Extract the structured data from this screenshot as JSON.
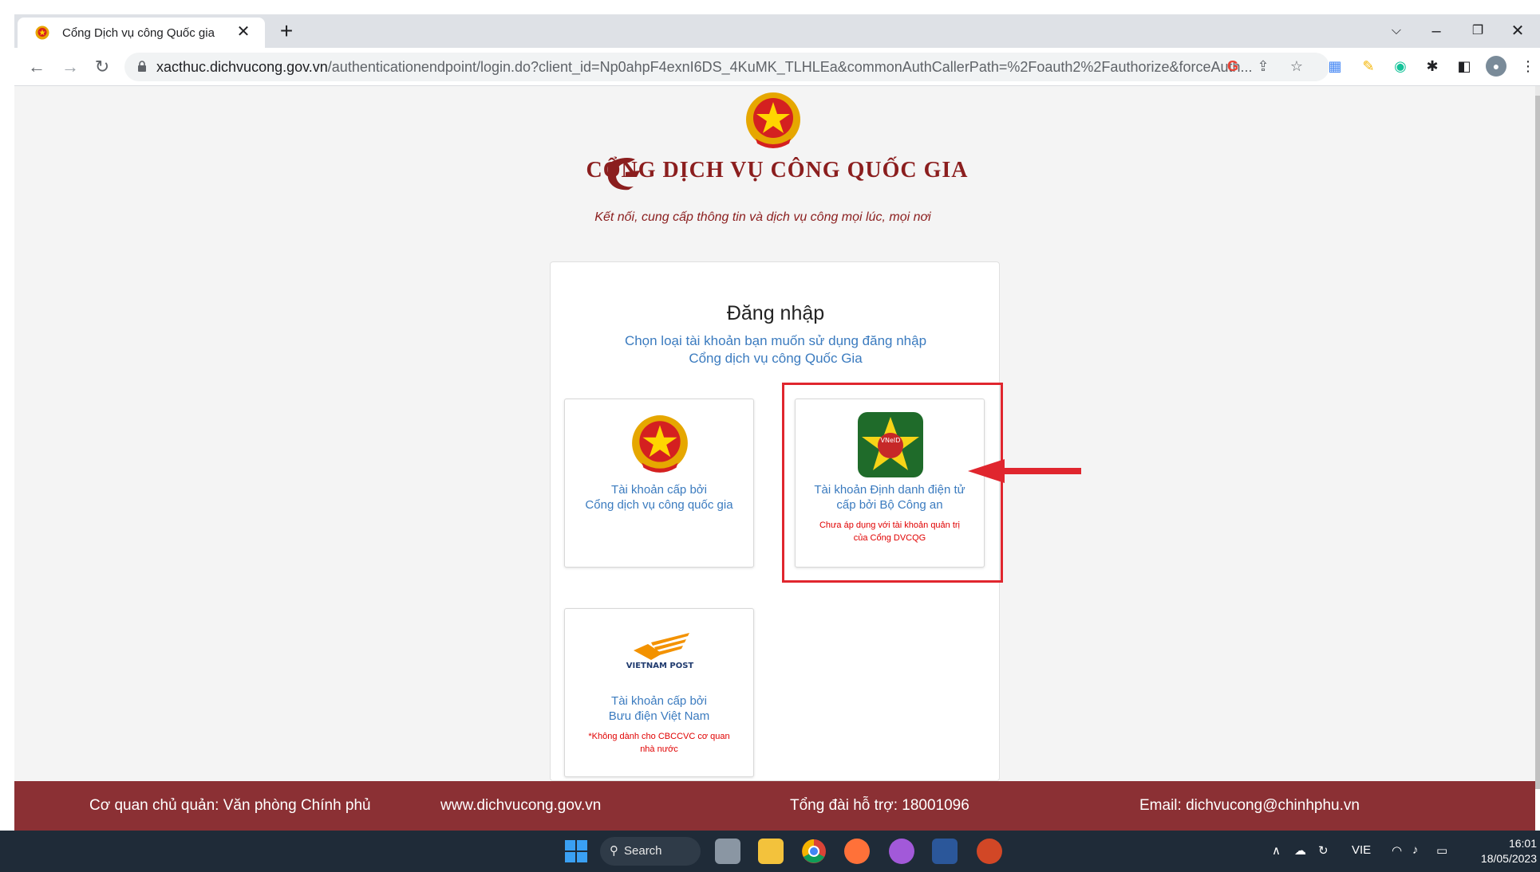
{
  "browser": {
    "tab_title": "Cổng Dịch vụ công Quốc gia",
    "tab_close": "✕",
    "new_tab": "+",
    "url_domain": "xacthuc.dichvucong.gov.vn",
    "url_path": "/authenticationendpoint/login.do?client_id=Np0ahpF4exnI6DS_4KuMK_TLHLEa&commonAuthCallerPath=%2Foauth2%2Fauthorize&forceAuth...",
    "icons": [
      "back-icon",
      "forward-icon",
      "reload-icon",
      "lock-icon",
      "google-icon",
      "share-icon",
      "star-icon",
      "extensions-icon",
      "sidepanel-icon",
      "profile-icon",
      "menu-icon"
    ]
  },
  "header": {
    "title": "CỔNG DỊCH VỤ CÔNG QUỐC GIA",
    "subtitle": "Kết nối, cung cấp thông tin và dịch vụ công mọi lúc, mọi nơi"
  },
  "login": {
    "title": "Đăng nhập",
    "subtitle_line1": "Chọn loại tài khoản bạn muốn sử dụng đăng nhập",
    "subtitle_line2": "Cổng dịch vụ công Quốc Gia",
    "options": [
      {
        "line1": "Tài khoản cấp bởi",
        "line2": "Cổng dịch vụ công quốc gia",
        "note1": "",
        "note2": ""
      },
      {
        "line1": "Tài khoản Định danh điện tử",
        "line2": "cấp bởi Bộ Công an",
        "note1": "Chưa áp dụng với tài khoản quản trị",
        "note2": "của Cổng DVCQG",
        "badge": "VNeID"
      },
      {
        "line1": "Tài khoản cấp bởi",
        "line2": "Bưu điện Việt Nam",
        "note1": "*Không dành cho CBCCVC cơ quan",
        "note2": "nhà nước",
        "logo_text": "VIETNAM POST"
      }
    ]
  },
  "footer": {
    "agency": "Cơ quan chủ quản: Văn phòng Chính phủ",
    "website": "www.dichvucong.gov.vn",
    "hotline": "Tổng đài hỗ trợ: 18001096",
    "email": "Email: dichvucong@chinhphu.vn"
  },
  "taskbar": {
    "search": "Search",
    "lang": "VIE",
    "time": "16:01",
    "date": "18/05/2023"
  },
  "colors": {
    "brand_red": "#8b1e1e",
    "footer_bg": "#8b3034",
    "link_blue": "#3b7bbf",
    "highlight_red": "#e0262e"
  }
}
